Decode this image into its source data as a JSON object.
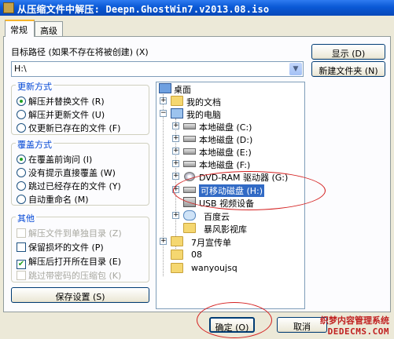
{
  "window": {
    "title": "从压缩文件中解压: Deepn.GhostWin7.v2013.08.iso"
  },
  "tabs": [
    "常规",
    "高级"
  ],
  "target": {
    "label": "目标路径 (如果不存在将被创建) (X)",
    "value": "H:\\",
    "show_button": "显示 (D)",
    "new_folder_button": "新建文件夹 (N)"
  },
  "update_mode": {
    "title": "更新方式",
    "options": [
      "解压并替换文件 (R)",
      "解压并更新文件 (U)",
      "仅更新已存在的文件 (F)"
    ],
    "selected": 0
  },
  "overwrite_mode": {
    "title": "覆盖方式",
    "options": [
      "在覆盖前询问 (I)",
      "没有提示直接覆盖 (W)",
      "跳过已经存在的文件 (Y)",
      "自动重命名 (M)"
    ],
    "selected": 0
  },
  "misc": {
    "title": "其他",
    "options": [
      {
        "label": "解压文件到单独目录 (Z)",
        "checked": false,
        "disabled": true
      },
      {
        "label": "保留损坏的文件 (P)",
        "checked": false,
        "disabled": false
      },
      {
        "label": "解压后打开所在目录 (E)",
        "checked": true,
        "disabled": false
      },
      {
        "label": "跳过带密码的压缩包 (K)",
        "checked": false,
        "disabled": true
      }
    ]
  },
  "save_settings_button": "保存设置 (S)",
  "tree": {
    "items": [
      {
        "label": "桌面",
        "icon": "desktop-icon",
        "expander": "-"
      },
      {
        "label": "我的文档",
        "icon": "folder-icon",
        "expander": "+"
      },
      {
        "label": "我的电脑",
        "icon": "computer-icon",
        "expander": "-"
      },
      {
        "label": "本地磁盘 (C:)",
        "icon": "drive-icon",
        "expander": "+"
      },
      {
        "label": "本地磁盘 (D:)",
        "icon": "drive-icon",
        "expander": "+"
      },
      {
        "label": "本地磁盘 (E:)",
        "icon": "drive-icon",
        "expander": "+"
      },
      {
        "label": "本地磁盘 (F:)",
        "icon": "drive-icon",
        "expander": "+"
      },
      {
        "label": "DVD-RAM 驱动器 (G:)",
        "icon": "dvd-icon",
        "expander": "+"
      },
      {
        "label": "可移动磁盘 (H:)",
        "icon": "drive-icon",
        "expander": "+",
        "selected": true
      },
      {
        "label": "USB 视频设备",
        "icon": "usb-camera-icon",
        "expander": ""
      },
      {
        "label": "百度云",
        "icon": "cloud-icon",
        "expander": "+"
      },
      {
        "label": "暴风影视库",
        "icon": "folder-icon",
        "expander": ""
      },
      {
        "label": "7月宣传单",
        "icon": "folder-icon",
        "expander": "+"
      },
      {
        "label": "08",
        "icon": "folder-icon",
        "expander": ""
      },
      {
        "label": "wanyoujsq",
        "icon": "folder-icon",
        "expander": ""
      }
    ]
  },
  "buttons": {
    "ok": "确定 (O)",
    "cancel": "取消"
  },
  "watermark": {
    "line1": "织梦内容管理系统",
    "line2": "DEDECMS.COM"
  },
  "colors": {
    "title_bar": "#0a59d6",
    "group_title": "#0046d5",
    "selection": "#316ac5",
    "annotation_red": "#d42020"
  }
}
